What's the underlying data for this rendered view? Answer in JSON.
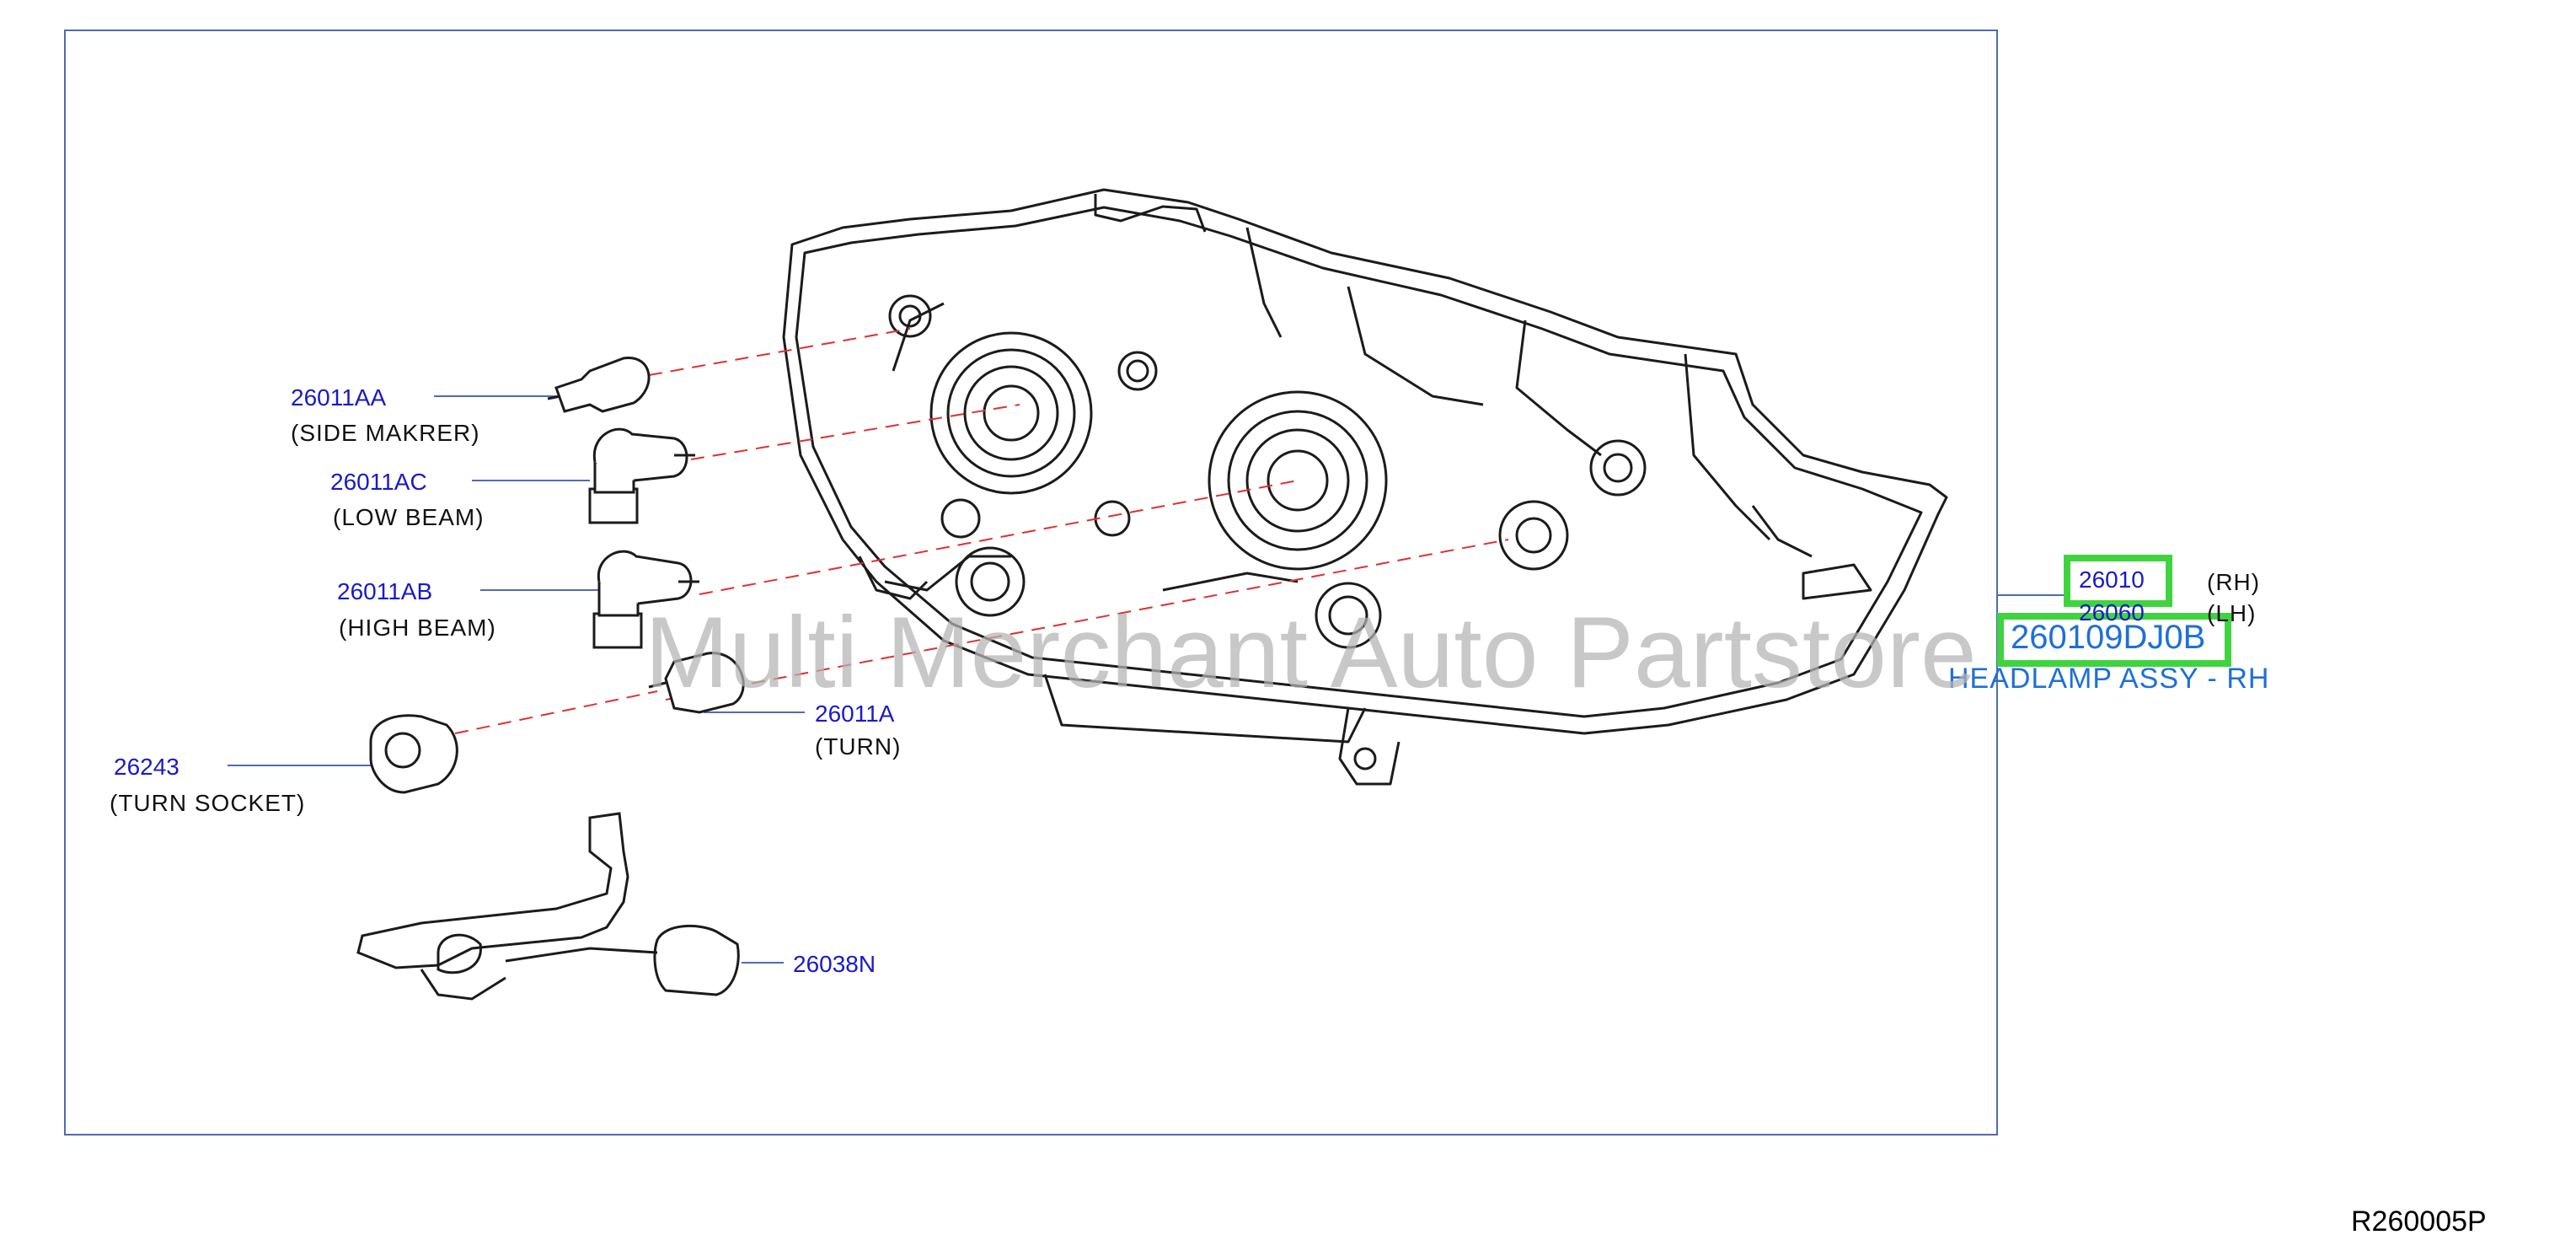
{
  "callouts": {
    "side_marker": {
      "part_no": "26011AA",
      "desc": "(SIDE   MAKRER)"
    },
    "low_beam": {
      "part_no": "26011AC",
      "desc": "(LOW   BEAM)"
    },
    "high_beam": {
      "part_no": "26011AB",
      "desc": "(HIGH   BEAM)"
    },
    "turn_bulb": {
      "part_no": "26011A",
      "desc": "(TURN)"
    },
    "turn_socket": {
      "part_no": "26243",
      "desc": "(TURN   SOCKET)"
    },
    "harness": {
      "part_no": "26038N"
    }
  },
  "assembly": {
    "rh_no": "26010",
    "rh_side": "(RH)",
    "lh_no": "26060",
    "lh_side": "(LH)",
    "oem_part": "260109DJ0B",
    "name": "HEADLAMP ASSY - RH"
  },
  "watermark": "Multi Merchant Auto Partstore",
  "figure_ref": "R260005P",
  "colors": {
    "frame": "#4f6bb3",
    "part_number_text": "#1a1ac8",
    "assembly_name_text": "#1e6fd9",
    "highlight": "#3fd43f",
    "leader_dash": "#e03030"
  }
}
